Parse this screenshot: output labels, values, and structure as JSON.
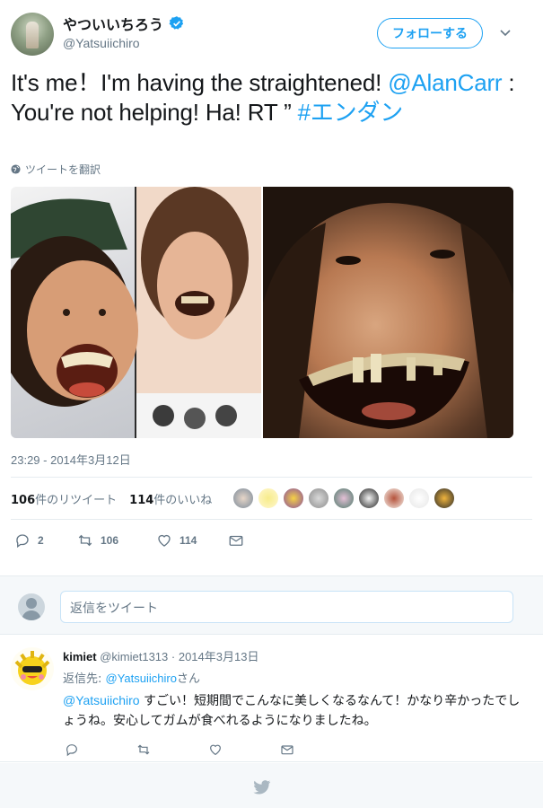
{
  "user": {
    "display_name": "やついいちろう",
    "handle": "@Yatsuiichiro",
    "follow_label": "フォローする"
  },
  "tweet": {
    "text_prefix": "It's me！I'm having the straightened! ",
    "mention": "@AlanCarr",
    "text_middle": " : You're not helping! Ha! RT ” ",
    "hashtag": "#エンダン",
    "translate_label": "ツイートを翻訳",
    "timestamp": "23:29 - 2014年3月12日"
  },
  "stats": {
    "retweets_count": "106",
    "retweets_label": "件のリツイート",
    "likes_count": "114",
    "likes_label": "件のいいね"
  },
  "actions": {
    "reply_count": "2",
    "retweet_count": "106",
    "like_count": "114"
  },
  "reply_box": {
    "placeholder": "返信をツイート"
  },
  "reply": {
    "display_name": "kimiet",
    "handle": "@kimiet1313",
    "separator": " · ",
    "date": "2014年3月13日",
    "reply_to_prefix": "返信先: ",
    "reply_to_handle": "@Yatsuiichiro",
    "reply_to_suffix": "さん",
    "body_mention": "@Yatsuiichiro",
    "body_text": " すごい！短期間でこんなに美しくなるなんて！かなり辛かったでしょうね。安心してガムが食べれるようになりましたね。"
  },
  "colors": {
    "accent": "#1da1f2",
    "text": "#14171a",
    "muted": "#657786",
    "border": "#e6ecf0"
  }
}
